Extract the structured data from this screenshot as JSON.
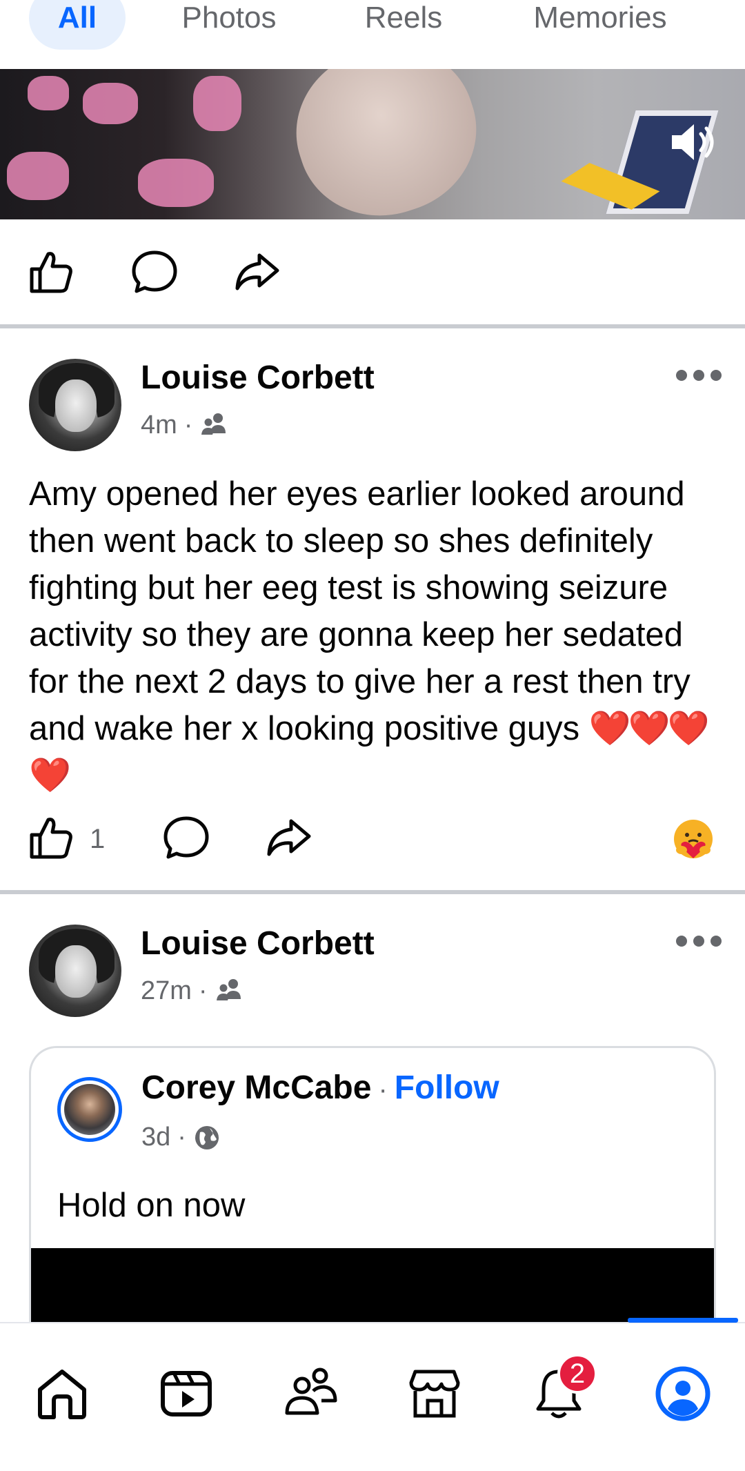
{
  "tabs": [
    {
      "label": "All",
      "active": true
    },
    {
      "label": "Photos",
      "active": false
    },
    {
      "label": "Reels",
      "active": false
    },
    {
      "label": "Memories",
      "active": false
    }
  ],
  "video_post": {
    "sound_icon": "speaker-on-icon",
    "actions": [
      "like-icon",
      "comment-icon",
      "share-icon"
    ]
  },
  "post1": {
    "author": "Louise Corbett",
    "time": "4m",
    "separator": "·",
    "audience_icon": "friends-icon",
    "text": "Amy opened her eyes earlier looked around then went back to sleep so shes definitely fighting but her eeg test is showing seizure activity so they are gonna keep her sedated for the next 2 days to give her a rest then try and wake her x looking positive guys ",
    "emoji": "❤️❤️❤️❤️",
    "like_count": "1",
    "reaction_icon": "care-reaction-icon"
  },
  "post2": {
    "author": "Louise Corbett",
    "time": "27m",
    "separator": "·",
    "audience_icon": "friends-icon",
    "shared": {
      "author": "Corey McCabe",
      "separator": "·",
      "follow_label": "Follow",
      "time": "3d",
      "audience_icon": "globe-icon",
      "text": "Hold on now"
    }
  },
  "bottom_nav": {
    "items": [
      "home-icon",
      "video-icon",
      "friends-icon",
      "marketplace-icon",
      "notifications-icon",
      "profile-icon"
    ],
    "notifications_badge": "2",
    "active": "profile-icon"
  },
  "colors": {
    "accent": "#0866ff",
    "badge": "#e41e3f",
    "secondary_text": "#65676b"
  }
}
